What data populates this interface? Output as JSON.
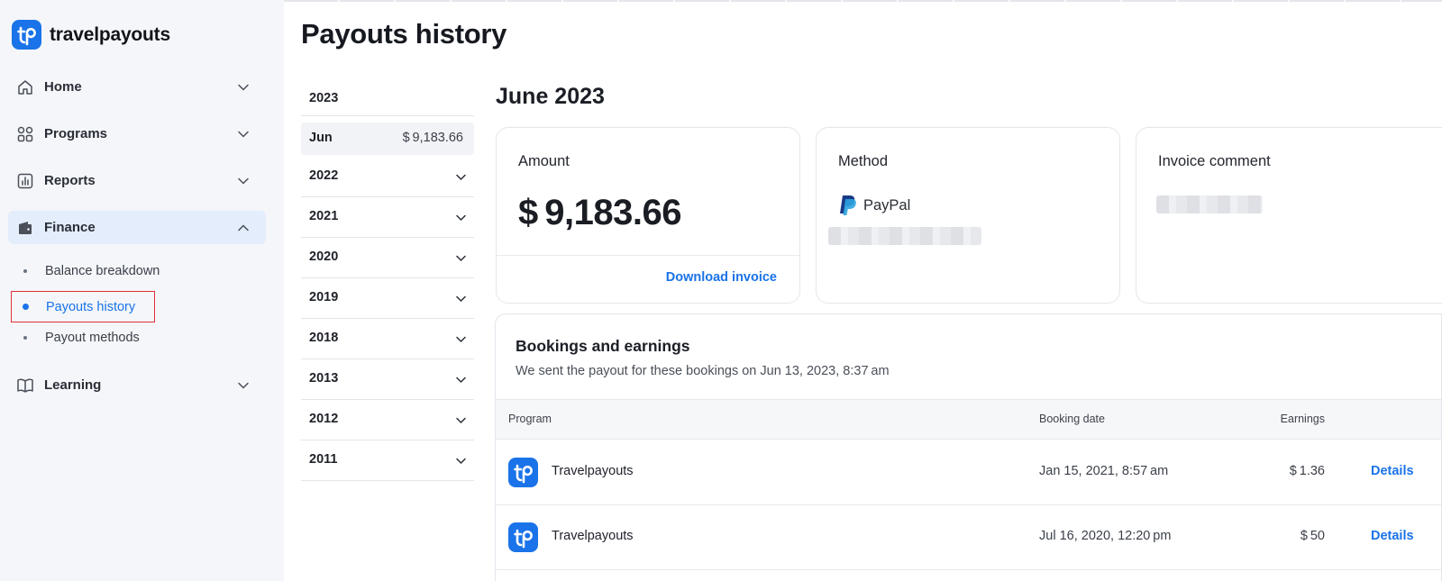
{
  "brand": {
    "name": "travelpayouts",
    "logo_icon": "travelpayouts-logo-icon"
  },
  "sidebar": {
    "items": [
      {
        "label": "Home",
        "icon": "home-icon"
      },
      {
        "label": "Programs",
        "icon": "grid-icon"
      },
      {
        "label": "Reports",
        "icon": "bar-chart-icon"
      },
      {
        "label": "Finance",
        "icon": "wallet-icon",
        "expanded": true
      },
      {
        "label": "Learning",
        "icon": "book-icon"
      }
    ],
    "finance_sub": [
      {
        "label": "Balance breakdown"
      },
      {
        "label": "Payouts history",
        "current": true
      },
      {
        "label": "Payout methods"
      }
    ]
  },
  "page": {
    "title": "Payouts history"
  },
  "years": {
    "open_year": "2023",
    "open_month": {
      "label": "Jun",
      "value": "$ 9,183.66"
    },
    "collapsed": [
      "2022",
      "2021",
      "2020",
      "2019",
      "2018",
      "2013",
      "2012",
      "2011"
    ]
  },
  "detail": {
    "title": "June 2023",
    "amount": {
      "label": "Amount",
      "value": "$ 9,183.66",
      "download": "Download invoice"
    },
    "method": {
      "label": "Method",
      "provider": "PayPal"
    },
    "invoice": {
      "label": "Invoice comment"
    }
  },
  "bookings": {
    "title": "Bookings and earnings",
    "subtitle": "We sent the payout for these bookings on Jun 13, 2023, 8:37 am",
    "columns": {
      "program": "Program",
      "date": "Booking date",
      "earnings": "Earnings"
    },
    "rows": [
      {
        "program": "Travelpayouts",
        "date": "Jan 15, 2021, 8:57 am",
        "earnings": "$ 1.36",
        "action": "Details"
      },
      {
        "program": "Travelpayouts",
        "date": "Jul 16, 2020, 12:20 pm",
        "earnings": "$ 50",
        "action": "Details"
      }
    ]
  },
  "colors": {
    "accent": "#1a73e8",
    "sidebar_bg": "#f4f6fa",
    "active_bg": "#e3edfb",
    "highlight_border": "#e0313a"
  }
}
